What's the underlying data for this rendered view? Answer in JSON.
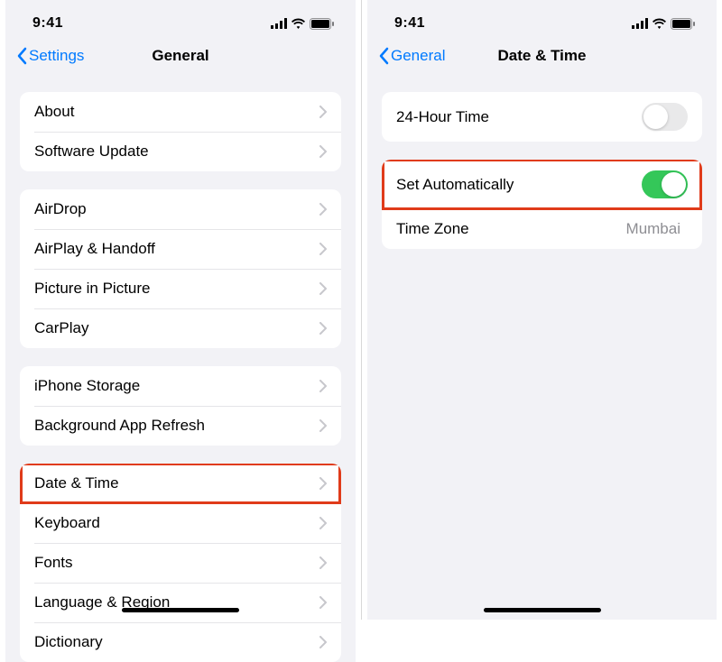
{
  "status": {
    "time": "9:41"
  },
  "left": {
    "back": "Settings",
    "title": "General",
    "groups": [
      {
        "items": [
          "About",
          "Software Update"
        ]
      },
      {
        "items": [
          "AirDrop",
          "AirPlay & Handoff",
          "Picture in Picture",
          "CarPlay"
        ]
      },
      {
        "items": [
          "iPhone Storage",
          "Background App Refresh"
        ]
      },
      {
        "items": [
          "Date & Time",
          "Keyboard",
          "Fonts",
          "Language & Region",
          "Dictionary"
        ]
      }
    ]
  },
  "right": {
    "back": "General",
    "title": "Date & Time",
    "rows": {
      "r24": "24-Hour Time",
      "auto": "Set Automatically",
      "tz_label": "Time Zone",
      "tz_value": "Mumbai"
    }
  }
}
